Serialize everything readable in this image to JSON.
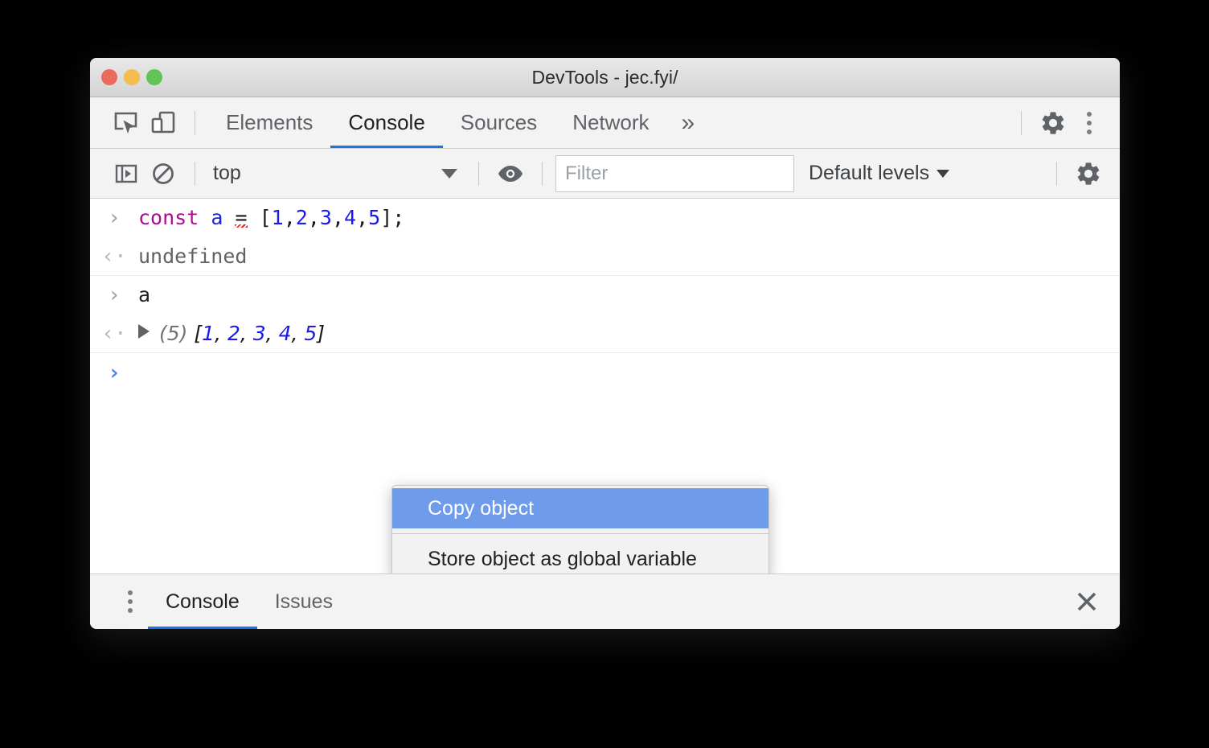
{
  "window": {
    "title": "DevTools - jec.fyi/",
    "traffic_lights": [
      "close",
      "minimize",
      "zoom"
    ],
    "colors": {
      "close": "#ec6a5e",
      "minimize": "#f4bd4f",
      "zoom": "#61c454",
      "accent": "#1a73e8",
      "menu_highlight": "#6e9ceb",
      "prompt_arrow": "#4285f4"
    }
  },
  "toolbar": {
    "inspect_icon": "inspect-element-icon",
    "device_icon": "device-toolbar-icon",
    "tabs": [
      {
        "label": "Elements",
        "active": false
      },
      {
        "label": "Console",
        "active": true
      },
      {
        "label": "Sources",
        "active": false
      },
      {
        "label": "Network",
        "active": false
      }
    ],
    "more_tabs_label": "»",
    "settings_icon": "gear-icon",
    "menu_icon": "kebab-menu-icon"
  },
  "console_toolbar": {
    "sidebar_toggle_icon": "console-sidebar-toggle-icon",
    "clear_icon": "clear-console-icon",
    "context_value": "top",
    "context_options": [
      "top"
    ],
    "eye_icon": "create-live-expression-icon",
    "filter_placeholder": "Filter",
    "filter_value": "",
    "levels_label": "Default levels",
    "settings_icon": "gear-icon"
  },
  "console_log": {
    "rows": [
      {
        "kind": "input",
        "gutter": "›",
        "tokens": [
          {
            "t": "const",
            "c": "kw"
          },
          {
            "t": " ",
            "c": "plain"
          },
          {
            "t": "a",
            "c": "ident"
          },
          {
            "t": " ",
            "c": "plain"
          },
          {
            "t": "=",
            "c": "op"
          },
          {
            "t": " ",
            "c": "plain"
          },
          {
            "t": "[",
            "c": "punct"
          },
          {
            "t": "1",
            "c": "num"
          },
          {
            "t": ",",
            "c": "punct"
          },
          {
            "t": "2",
            "c": "num"
          },
          {
            "t": ",",
            "c": "punct"
          },
          {
            "t": "3",
            "c": "num"
          },
          {
            "t": ",",
            "c": "punct"
          },
          {
            "t": "4",
            "c": "num"
          },
          {
            "t": ",",
            "c": "punct"
          },
          {
            "t": "5",
            "c": "num"
          },
          {
            "t": "]",
            "c": "punct"
          },
          {
            "t": ";",
            "c": "punct"
          }
        ],
        "text": "const a = [1,2,3,4,5];"
      },
      {
        "kind": "output",
        "gutter": "‹·",
        "text": "undefined"
      },
      {
        "kind": "input",
        "gutter": "›",
        "text": "a"
      },
      {
        "kind": "output",
        "gutter": "‹·",
        "expander": "▶",
        "array_count": "(5)",
        "array_open": "[",
        "array_values": [
          "1",
          "2",
          "3",
          "4",
          "5"
        ],
        "array_close": "]",
        "text": "(5) [1, 2, 3, 4, 5]"
      }
    ],
    "prompt_arrow": "›",
    "prompt_value": ""
  },
  "context_menu": {
    "items": [
      {
        "label": "Copy object",
        "selected": true
      },
      {
        "label": "Store object as global variable",
        "selected": false
      }
    ]
  },
  "drawer": {
    "menu_icon": "kebab-menu-icon",
    "tabs": [
      {
        "label": "Console",
        "active": true
      },
      {
        "label": "Issues",
        "active": false
      }
    ],
    "close_icon": "close-icon"
  }
}
